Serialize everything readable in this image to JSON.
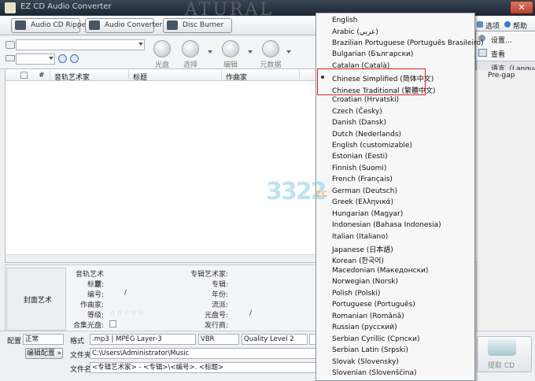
{
  "window": {
    "title": "EZ CD Audio Converter",
    "background_text": "ATURAL",
    "close_label": "✕"
  },
  "tabs": [
    {
      "label": "Audio CD Ripper"
    },
    {
      "label": "Audio Converter"
    },
    {
      "label": "Disc Burner"
    }
  ],
  "toolbar": {
    "tools": [
      {
        "label": "光盘",
        "icon": "cd-icon"
      },
      {
        "label": "选择",
        "icon": "select-disc-icon"
      },
      {
        "label": "编辑",
        "icon": "edit-icon"
      },
      {
        "label": "元数据",
        "icon": "metadata-icon"
      }
    ]
  },
  "grid": {
    "columns": [
      "#",
      "音轨艺术家",
      "标题",
      "作曲家"
    ],
    "pregap_label": "Pre-gap"
  },
  "right_menu": {
    "options_label": "选项",
    "help_label": "帮助",
    "items": [
      "设置...",
      "查看",
      "语言（Language"
    ]
  },
  "info": {
    "cover_label": "封面艺术",
    "left_labels": [
      "音轨艺术家:",
      "标题:",
      "编号:",
      "作曲家:",
      "等级:",
      "合集光盘:"
    ],
    "track_number_sep": "/",
    "rating_stars": "☆☆☆☆☆",
    "right_labels": [
      "专辑艺术家:",
      "专辑:",
      "年份:",
      "流派:",
      "光盘号:",
      "发行商:"
    ],
    "disc_number_sep": "/"
  },
  "bottom": {
    "profile_label": "配置",
    "profile_value": "正常",
    "edit_profile_button": "编辑配置 »",
    "format_label": "格式",
    "format_value": ".mp3 | MPEG Layer-3",
    "vbr_value": "VBR",
    "quality_value": "Quality Level 2",
    "folder_label": "文件夹",
    "folder_value": "C:\\Users\\Administrator\\Music",
    "filename_label": "文件名",
    "filename_value": "<专辑艺术家> - <专辑>\\<编号>. <标题>",
    "rip_button": "提取 CD"
  },
  "language_menu": {
    "selected": "Chinese Simplified (简体中文)",
    "items": [
      "English",
      "Arabic (عربي)",
      "Brazilian Portuguese (Português Brasileiro)",
      "Bulgarian (Български)",
      "Catalan (Català)",
      "Chinese Simplified (简体中文)",
      "Chinese Traditional (繁體中文)",
      "Croatian (Hrvatski)",
      "Czech (Česky)",
      "Danish (Dansk)",
      "Dutch (Nederlands)",
      "English (customizable)",
      "Estonian (Eesti)",
      "Finnish (Suomi)",
      "French (Français)",
      "German (Deutsch)",
      "Greek (Ελληνικά)",
      "Hungarian (Magyar)",
      "Indonesian (Bahasa Indonesia)",
      "Italian (Italiano)",
      "Japanese (日本語)",
      "Korean (한국어)",
      "Macedonian (Македонски)",
      "Norwegian (Norsk)",
      "Polish (Polski)",
      "Portuguese (Português)",
      "Romanian (Română)",
      "Russian (русский)",
      "Serbian Cyrillic (Српски)",
      "Serbian Latin (Srpski)",
      "Slovak (Slovensky)",
      "Slovenian (Slovenščina)"
    ]
  },
  "watermark": {
    "text": "3322",
    "suffix": "cc"
  }
}
